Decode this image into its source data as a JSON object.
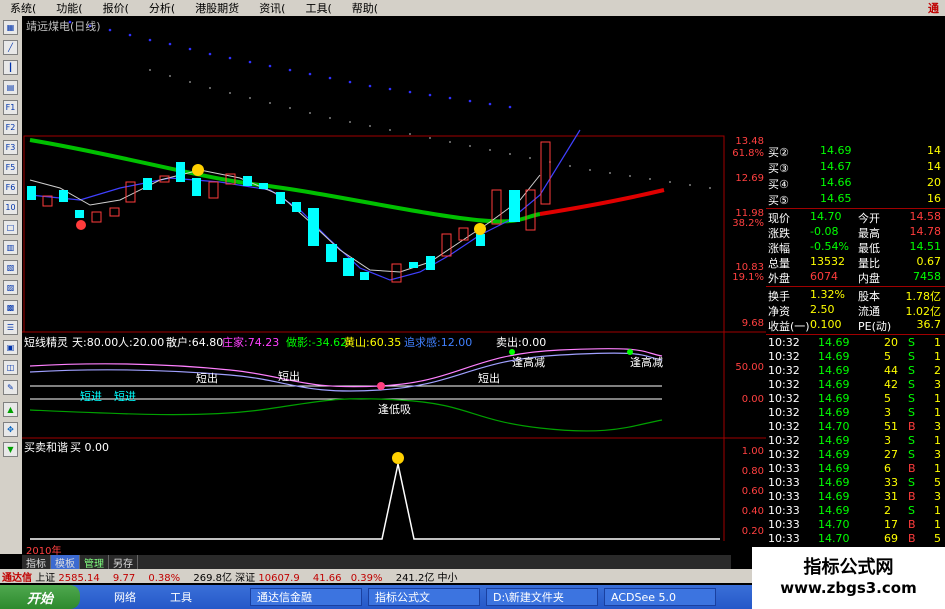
{
  "menu": [
    "系统(",
    "功能(",
    "报价(",
    "分析(",
    "港股期货",
    "资讯(",
    "工具(",
    "帮助("
  ],
  "menu_brand": "通",
  "chart_title": "靖远煤电(日线)",
  "main_axis": [
    "13.48",
    "61.8%",
    "12.69",
    "11.98",
    "38.2%",
    "10.83",
    "19.1%",
    "9.68"
  ],
  "indicator_header": {
    "name": "短线精灵",
    "tian": "天:80.00",
    "ren": "人:20.00",
    "sanhu": "散户:64.80",
    "zhuangjia": "庄家:74.23",
    "diaoyu": "做影:-34.62",
    "huangshan": "黄山:60.35",
    "mairu": "追求感:12.00",
    "maichu": "卖出:0.00"
  },
  "indicator_axis": [
    "50.00",
    "0.00"
  ],
  "indicator_labels": [
    "短出",
    "短出",
    "短出",
    "短进",
    "短进",
    "逢低吸",
    "逢高减",
    "逢高减"
  ],
  "third_header": {
    "name": "买卖和谐",
    "buy": "买 0.00"
  },
  "third_axis": [
    "1.00",
    "0.80",
    "0.60",
    "0.40",
    "0.20"
  ],
  "year_label": "2010年",
  "bottom_tabs": [
    "指标",
    "模板",
    "管理",
    "另存"
  ],
  "order_book": [
    {
      "label": "买②",
      "price": "14.69",
      "vol": "14"
    },
    {
      "label": "买③",
      "price": "14.67",
      "vol": "14"
    },
    {
      "label": "买④",
      "price": "14.66",
      "vol": "20"
    },
    {
      "label": "买⑤",
      "price": "14.65",
      "vol": "16"
    }
  ],
  "quote": [
    {
      "k1": "现价",
      "v1": "14.70",
      "k2": "今开",
      "v2": "14.58"
    },
    {
      "k1": "涨跌",
      "v1": "-0.08",
      "k2": "最高",
      "v2": "14.78"
    },
    {
      "k1": "涨幅",
      "v1": "-0.54%",
      "k2": "最低",
      "v2": "14.51"
    },
    {
      "k1": "总量",
      "v1": "13532",
      "k2": "量比",
      "v2": "0.67"
    },
    {
      "k1": "外盘",
      "v1": "6074",
      "k2": "内盘",
      "v2": "7458"
    },
    {
      "k1": "换手",
      "v1": "1.32%",
      "k2": "股本",
      "v2": "1.78亿"
    },
    {
      "k1": "净资",
      "v1": "2.50",
      "k2": "流通",
      "v2": "1.02亿"
    },
    {
      "k1": "收益(一)",
      "v1": "0.100",
      "k2": "PE(动)",
      "v2": "36.7"
    }
  ],
  "ticks": [
    {
      "time": "10:32",
      "price": "14.69",
      "vol": "20",
      "side": "S",
      "n": "1"
    },
    {
      "time": "10:32",
      "price": "14.69",
      "vol": "5",
      "side": "S",
      "n": "1"
    },
    {
      "time": "10:32",
      "price": "14.69",
      "vol": "44",
      "side": "S",
      "n": "2"
    },
    {
      "time": "10:32",
      "price": "14.69",
      "vol": "42",
      "side": "S",
      "n": "3"
    },
    {
      "time": "10:32",
      "price": "14.69",
      "vol": "5",
      "side": "S",
      "n": "1"
    },
    {
      "time": "10:32",
      "price": "14.69",
      "vol": "3",
      "side": "S",
      "n": "1"
    },
    {
      "time": "10:32",
      "price": "14.70",
      "vol": "51",
      "side": "B",
      "n": "3"
    },
    {
      "time": "10:32",
      "price": "14.69",
      "vol": "3",
      "side": "S",
      "n": "1"
    },
    {
      "time": "10:32",
      "price": "14.69",
      "vol": "27",
      "side": "S",
      "n": "3"
    },
    {
      "time": "10:33",
      "price": "14.69",
      "vol": "6",
      "side": "B",
      "n": "1"
    },
    {
      "time": "10:33",
      "price": "14.69",
      "vol": "33",
      "side": "S",
      "n": "5"
    },
    {
      "time": "10:33",
      "price": "14.69",
      "vol": "31",
      "side": "B",
      "n": "3"
    },
    {
      "time": "10:33",
      "price": "14.69",
      "vol": "2",
      "side": "S",
      "n": "1"
    },
    {
      "time": "10:33",
      "price": "14.70",
      "vol": "17",
      "side": "B",
      "n": "1"
    },
    {
      "time": "10:33",
      "price": "14.70",
      "vol": "69",
      "side": "B",
      "n": "5"
    }
  ],
  "statusbar": {
    "app": "通达信",
    "sh_label": "上证",
    "sh": "2585.14",
    "sh_chg": "9.77",
    "sh_pct": "0.38%",
    "sh_amt": "269.8亿",
    "sz_label": "深证",
    "sz": "10607.9",
    "sz_chg": "41.66",
    "sz_pct": "0.39%",
    "sz_amt": "241.2亿",
    "tail": "中小"
  },
  "taskbar": {
    "start": "开始",
    "net": "网络",
    "tools": "工具",
    "items": [
      "通达信金融",
      "指标公式文",
      "D:\\新建文件夹",
      "ACDSee 5.0"
    ]
  },
  "watermark": {
    "line1": "指标公式网",
    "line2": "www.zbgs3.com"
  },
  "colors": {
    "up": "#ff3c3c",
    "down": "#00ffff",
    "ma_green": "#00c000",
    "ma_red": "#e00000",
    "dots": "#3030ff"
  }
}
